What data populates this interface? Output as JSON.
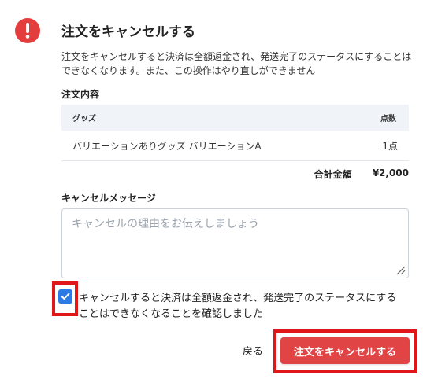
{
  "dialog": {
    "title": "注文をキャンセルする",
    "description": "注文をキャンセルすると決済は全額返金され、発送完了のステータスにすることはできなくなります。また、この操作はやり直しができません"
  },
  "order": {
    "section_label": "注文内容",
    "columns": {
      "item": "グッズ",
      "qty": "点数"
    },
    "rows": [
      {
        "item": "バリエーションありグッズ バリエーションA",
        "qty": "1点"
      }
    ],
    "total_label": "合計金額",
    "total_value": "¥2,000"
  },
  "message": {
    "section_label": "キャンセルメッセージ",
    "value": "",
    "placeholder": "キャンセルの理由をお伝えしましょう"
  },
  "confirm": {
    "checked": true,
    "line1": "キャンセルすると決済は全額返金され、発送完了のステータスにする",
    "line2": "ことはできなくなることを確認しました"
  },
  "actions": {
    "back_label": "戻る",
    "cancel_label": "注文をキャンセルする"
  },
  "colors": {
    "danger": "#e04444",
    "checkbox": "#2c7be5",
    "highlight": "#e0161b",
    "table_header_bg": "#f0f4f8"
  }
}
